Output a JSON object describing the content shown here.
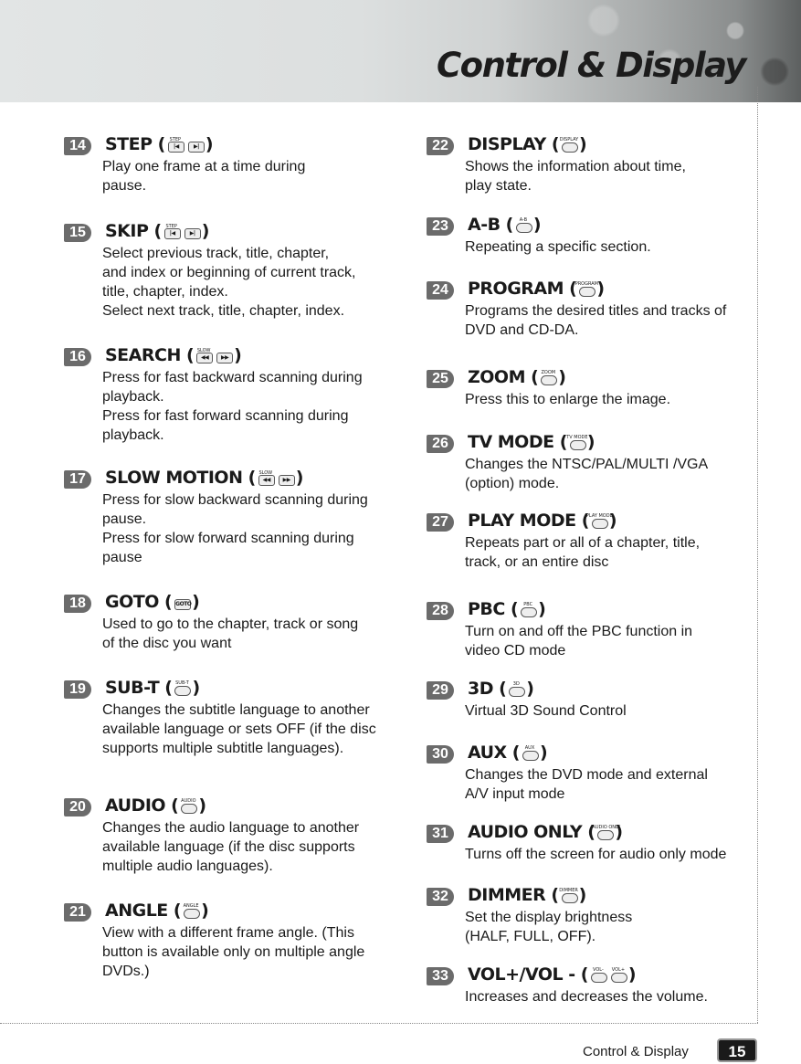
{
  "header": {
    "title": "Control & Display"
  },
  "footer": {
    "section_label": "Control & Display",
    "page_number": "15"
  },
  "items": [
    {
      "num": "14",
      "title": "STEP (",
      "close": ")",
      "icons": [
        {
          "name": "step-back-button-icon",
          "label": "STEP",
          "glyph": "|◀"
        },
        {
          "name": "step-forward-button-icon",
          "label": "",
          "glyph": "▶|"
        }
      ],
      "desc": "Play one frame at a time during\npause."
    },
    {
      "num": "15",
      "title": "SKIP (",
      "close": ")",
      "icons": [
        {
          "name": "skip-back-button-icon",
          "label": "STEP",
          "glyph": "|◀"
        },
        {
          "name": "skip-forward-button-icon",
          "label": "",
          "glyph": "▶|"
        }
      ],
      "desc": "Select previous track, title, chapter,\nand index or beginning of current track,\ntitle, chapter, index.\nSelect next track, title, chapter, index."
    },
    {
      "num": "16",
      "title": "SEARCH (",
      "close": ")",
      "icons": [
        {
          "name": "rewind-button-icon",
          "label": "SLOW",
          "glyph": "◀◀"
        },
        {
          "name": "fast-forward-button-icon",
          "label": "",
          "glyph": "▶▶"
        }
      ],
      "desc": "Press for fast backward scanning during\nplayback.\nPress for fast forward scanning during\nplayback."
    },
    {
      "num": "17",
      "title": "SLOW MOTION (",
      "close": ")",
      "icons": [
        {
          "name": "slow-back-button-icon",
          "label": "SLOW",
          "glyph": "◀◀"
        },
        {
          "name": "slow-forward-button-icon",
          "label": "",
          "glyph": "▶▶"
        }
      ],
      "desc": "Press for slow backward scanning during\npause.\nPress for slow forward scanning during\npause"
    },
    {
      "num": "18",
      "title": "GOTO (",
      "close": ")",
      "icons": [
        {
          "name": "goto-button-icon",
          "label": "",
          "glyph": "GOTO"
        }
      ],
      "desc": "Used to go to the chapter, track or song\nof the disc you want"
    },
    {
      "num": "19",
      "title": "SUB-T (",
      "close": ")",
      "icons": [
        {
          "name": "subtitle-button-icon",
          "label": "SUB-T",
          "glyph": ""
        }
      ],
      "desc": "Changes the subtitle language to another\navailable language or sets OFF (if the disc\nsupports multiple subtitle languages)."
    },
    {
      "num": "20",
      "title": "AUDIO (",
      "close": ")",
      "icons": [
        {
          "name": "audio-button-icon",
          "label": "AUDIO",
          "glyph": ""
        }
      ],
      "desc": "Changes the audio language to another\navailable language (if the disc supports\nmultiple audio languages)."
    },
    {
      "num": "21",
      "title": "ANGLE (",
      "close": ")",
      "icons": [
        {
          "name": "angle-button-icon",
          "label": "ANGLE",
          "glyph": ""
        }
      ],
      "desc": "View with a different frame angle. (This\nbutton is available only on multiple angle\nDVDs.)"
    },
    {
      "num": "22",
      "title": "DISPLAY (",
      "close": ")",
      "icons": [
        {
          "name": "display-button-icon",
          "label": "DISPLAY",
          "glyph": ""
        }
      ],
      "desc": "Shows the information about time,\nplay state."
    },
    {
      "num": "23",
      "title": "A-B (",
      "close": ")",
      "icons": [
        {
          "name": "a-b-button-icon",
          "label": "A-B",
          "glyph": ""
        }
      ],
      "desc": "Repeating a specific section."
    },
    {
      "num": "24",
      "title": "PROGRAM (",
      "close": ")",
      "icons": [
        {
          "name": "program-button-icon",
          "label": "PROGRAM",
          "glyph": ""
        }
      ],
      "desc": "Programs the desired titles and tracks of\nDVD and CD-DA."
    },
    {
      "num": "25",
      "title": "ZOOM (",
      "close": ")",
      "icons": [
        {
          "name": "zoom-button-icon",
          "label": "ZOOM",
          "glyph": ""
        }
      ],
      "desc": "Press this to enlarge the image."
    },
    {
      "num": "26",
      "title": "TV MODE (",
      "close": ")",
      "icons": [
        {
          "name": "tv-mode-button-icon",
          "label": "TV MODE",
          "glyph": ""
        }
      ],
      "desc": "Changes the NTSC/PAL/MULTI /VGA\n(option) mode."
    },
    {
      "num": "27",
      "title": "PLAY MODE (",
      "close": ")",
      "icons": [
        {
          "name": "play-mode-button-icon",
          "label": "PLAY MODE",
          "glyph": ""
        }
      ],
      "desc": "Repeats part or all of a chapter, title,\ntrack, or an entire disc"
    },
    {
      "num": "28",
      "title": "PBC (",
      "close": ")",
      "icons": [
        {
          "name": "pbc-button-icon",
          "label": "PBC",
          "glyph": ""
        }
      ],
      "desc": "Turn on and off the PBC function in\nvideo CD mode"
    },
    {
      "num": "29",
      "title": "3D (",
      "close": ")",
      "icons": [
        {
          "name": "3d-button-icon",
          "label": "3D",
          "glyph": ""
        }
      ],
      "desc": "Virtual 3D Sound Control"
    },
    {
      "num": "30",
      "title": "AUX (",
      "close": ")",
      "icons": [
        {
          "name": "aux-button-icon",
          "label": "AUX",
          "glyph": ""
        }
      ],
      "desc": "Changes the DVD mode and external\nA/V input mode"
    },
    {
      "num": "31",
      "title": "AUDIO ONLY (",
      "close": ")",
      "icons": [
        {
          "name": "audio-only-button-icon",
          "label": "AUDIO ONLY",
          "glyph": ""
        }
      ],
      "desc": "Turns off the screen for audio only mode"
    },
    {
      "num": "32",
      "title": "DIMMER (",
      "close": ")",
      "icons": [
        {
          "name": "dimmer-button-icon",
          "label": "DIMMER",
          "glyph": ""
        }
      ],
      "desc": "Set the display brightness\n(HALF, FULL, OFF)."
    },
    {
      "num": "33",
      "title": "VOL+/VOL - (",
      "close": ")",
      "icons": [
        {
          "name": "vol-minus-button-icon",
          "label": "VOL-",
          "glyph": ""
        },
        {
          "name": "vol-plus-button-icon",
          "label": "VOL+",
          "glyph": ""
        }
      ],
      "desc": "Increases and decreases the volume."
    }
  ]
}
